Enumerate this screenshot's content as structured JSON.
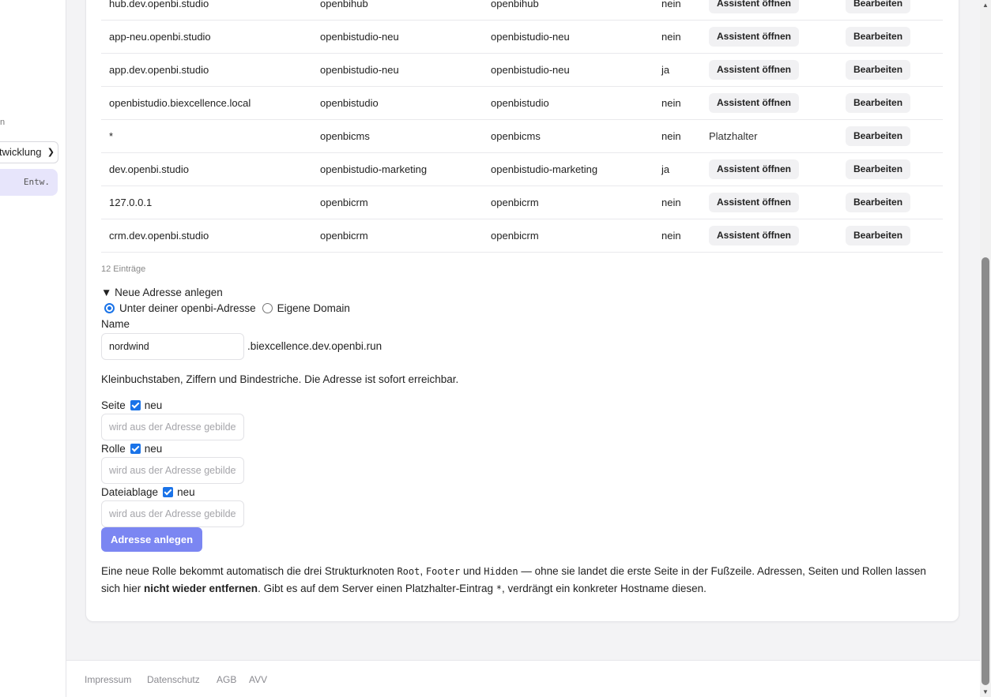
{
  "sidebar": {
    "label_fragment": "n",
    "env_select_value": "twicklung",
    "active_item": "Entw."
  },
  "table": {
    "rows": [
      {
        "hostname": "hub.dev.openbi.studio",
        "col2": "openbihub",
        "col3": "openbihub",
        "flag": "nein",
        "assistant": "Assistent öffnen",
        "edit": "Bearbeiten"
      },
      {
        "hostname": "app-neu.openbi.studio",
        "col2": "openbistudio-neu",
        "col3": "openbistudio-neu",
        "flag": "nein",
        "assistant": "Assistent öffnen",
        "edit": "Bearbeiten"
      },
      {
        "hostname": "app.dev.openbi.studio",
        "col2": "openbistudio-neu",
        "col3": "openbistudio-neu",
        "flag": "ja",
        "assistant": "Assistent öffnen",
        "edit": "Bearbeiten"
      },
      {
        "hostname": "openbistudio.biexcellence.local",
        "col2": "openbistudio",
        "col3": "openbistudio",
        "flag": "nein",
        "assistant": "Assistent öffnen",
        "edit": "Bearbeiten"
      },
      {
        "hostname": "*",
        "col2": "openbicms",
        "col3": "openbicms",
        "flag": "nein",
        "placeholder_text": "Platzhalter",
        "edit": "Bearbeiten"
      },
      {
        "hostname": "dev.openbi.studio",
        "col2": "openbistudio-marketing",
        "col3": "openbistudio-marketing",
        "flag": "ja",
        "assistant": "Assistent öffnen",
        "edit": "Bearbeiten"
      },
      {
        "hostname": "127.0.0.1",
        "col2": "openbicrm",
        "col3": "openbicrm",
        "flag": "nein",
        "assistant": "Assistent öffnen",
        "edit": "Bearbeiten"
      },
      {
        "hostname": "crm.dev.openbi.studio",
        "col2": "openbicrm",
        "col3": "openbicrm",
        "flag": "nein",
        "assistant": "Assistent öffnen",
        "edit": "Bearbeiten"
      }
    ],
    "count_label": "12 Einträge"
  },
  "form": {
    "summary": "▼ Neue Adresse anlegen",
    "radio_option_1": "Unter deiner openbi-Adresse",
    "radio_option_2": "Eigene Domain",
    "name_label": "Name",
    "name_value": "nordwind",
    "domain_suffix": ".biexcellence.dev.openbi.run",
    "hint": "Kleinbuchstaben, Ziffern und Bindestriche. Die Adresse ist sofort erreichbar.",
    "page_label": "Seite",
    "role_label": "Rolle",
    "storage_label": "Dateiablage",
    "new_label": "neu",
    "derived_placeholder": "wird aus der Adresse gebildet",
    "submit_label": "Adresse anlegen"
  },
  "note": {
    "part1": "Eine neue Rolle bekommt automatisch die drei Strukturknoten ",
    "code_root": "Root",
    "sep1": ", ",
    "code_footer": "Footer",
    "sep2": " und ",
    "code_hidden": "Hidden",
    "part2": " — ohne sie landet die erste Seite in der Fußzeile. Adressen, Seiten und Rollen lassen sich hier ",
    "bold": "nicht wieder entfernen",
    "part3": ". Gibt es auf dem Server einen Platzhalter-Eintrag ",
    "code_star": "*",
    "part4": ", verdrängt ein konkreter Hostname diesen."
  },
  "footer": {
    "links": [
      "Impressum",
      "Datenschutz",
      "AGB",
      "AVV"
    ]
  },
  "colors": {
    "accent": "#7b86f2",
    "checkbox": "#1a73e8",
    "active_nav": "#e7e5fb"
  }
}
